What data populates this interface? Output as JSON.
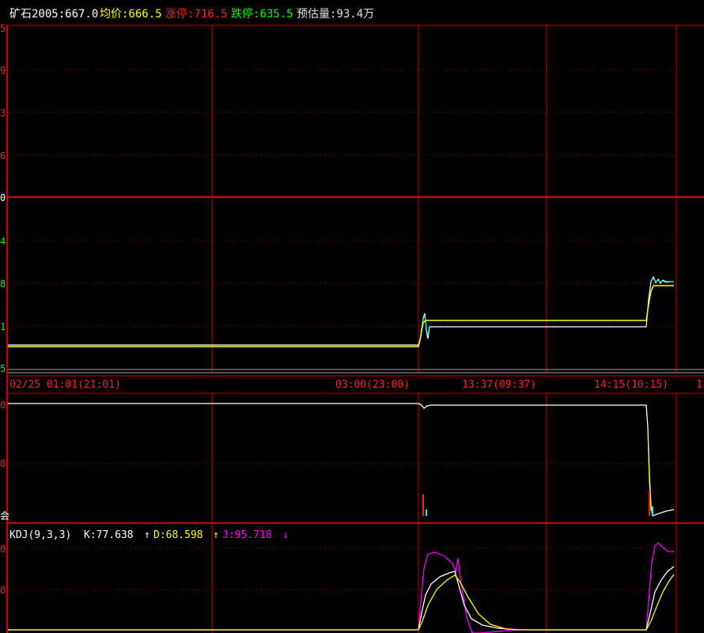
{
  "header": {
    "instrument": "矿石2005:667.0",
    "avg": "均价:666.5",
    "limit_up": "涨停:716.5",
    "limit_down": "跌停:635.5",
    "est_volume": "预估量:93.4万"
  },
  "price_axis": {
    "labels": [
      "5",
      "9",
      "3",
      "6",
      "0",
      "4",
      "8",
      "1",
      "5"
    ]
  },
  "time_axis": {
    "labels": [
      "02/25 01:01(21:01)",
      "03:00(23:00)",
      "13:37(09:37)",
      "14:15(10:15)",
      "1"
    ]
  },
  "volume_axis": {
    "labels": [
      "0",
      "0",
      "会"
    ]
  },
  "kdj": {
    "label": "KDJ(9,3,3)",
    "k": "K:77.638",
    "k_arrow": "↑",
    "d": "D:68.598",
    "d_arrow": "↑",
    "j": "J:95.718",
    "j_arrow": "↓",
    "axis_labels": [
      "0",
      "0"
    ]
  },
  "colors": {
    "grid": "#cc0000",
    "price": "#ffffff",
    "avg": "#ffff00",
    "limit_up": "#ff0000",
    "limit_down": "#00ff00",
    "magenta": "#ff00ff"
  }
}
